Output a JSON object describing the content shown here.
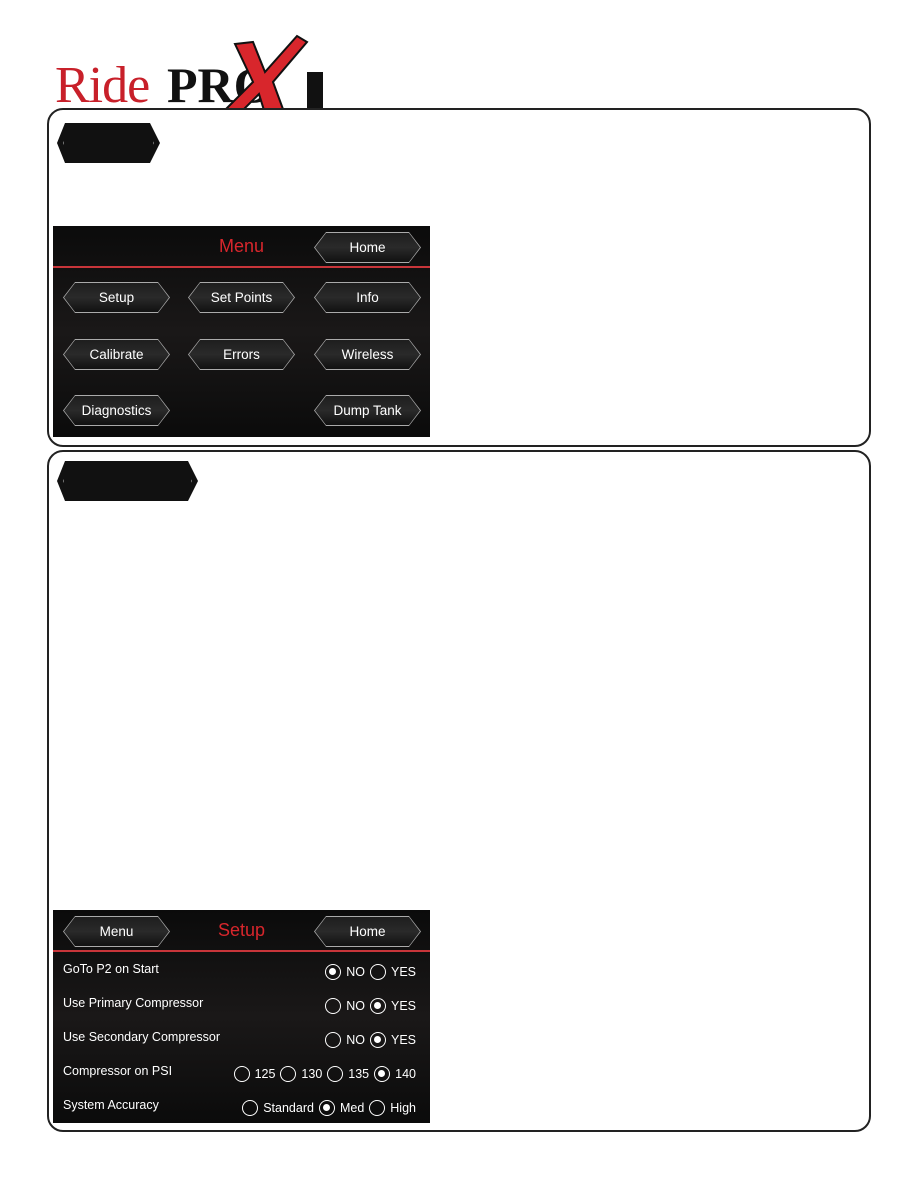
{
  "logo": {
    "ride": "Ride",
    "pro": "PRO",
    "x": "X"
  },
  "menu_screen": {
    "title": "Menu",
    "home": "Home",
    "buttons": [
      "Setup",
      "Set Points",
      "Info",
      "Calibrate",
      "Errors",
      "Wireless",
      "Diagnostics",
      "Dump Tank"
    ]
  },
  "setup_screen": {
    "title": "Setup",
    "menu": "Menu",
    "home": "Home",
    "rows": [
      {
        "label": "GoTo P2 on Start",
        "options": [
          "NO",
          "YES"
        ],
        "selected": "NO"
      },
      {
        "label": "Use Primary Compressor",
        "options": [
          "NO",
          "YES"
        ],
        "selected": "YES"
      },
      {
        "label": "Use Secondary Compressor",
        "options": [
          "NO",
          "YES"
        ],
        "selected": "YES"
      },
      {
        "label": "Compressor on PSI",
        "options": [
          "125",
          "130",
          "135",
          "140"
        ],
        "selected": "140"
      },
      {
        "label": "System Accuracy",
        "options": [
          "Standard",
          "Med",
          "High"
        ],
        "selected": "Med"
      }
    ]
  },
  "colors": {
    "accent": "#d8262c",
    "screen_bg": "#111111"
  }
}
